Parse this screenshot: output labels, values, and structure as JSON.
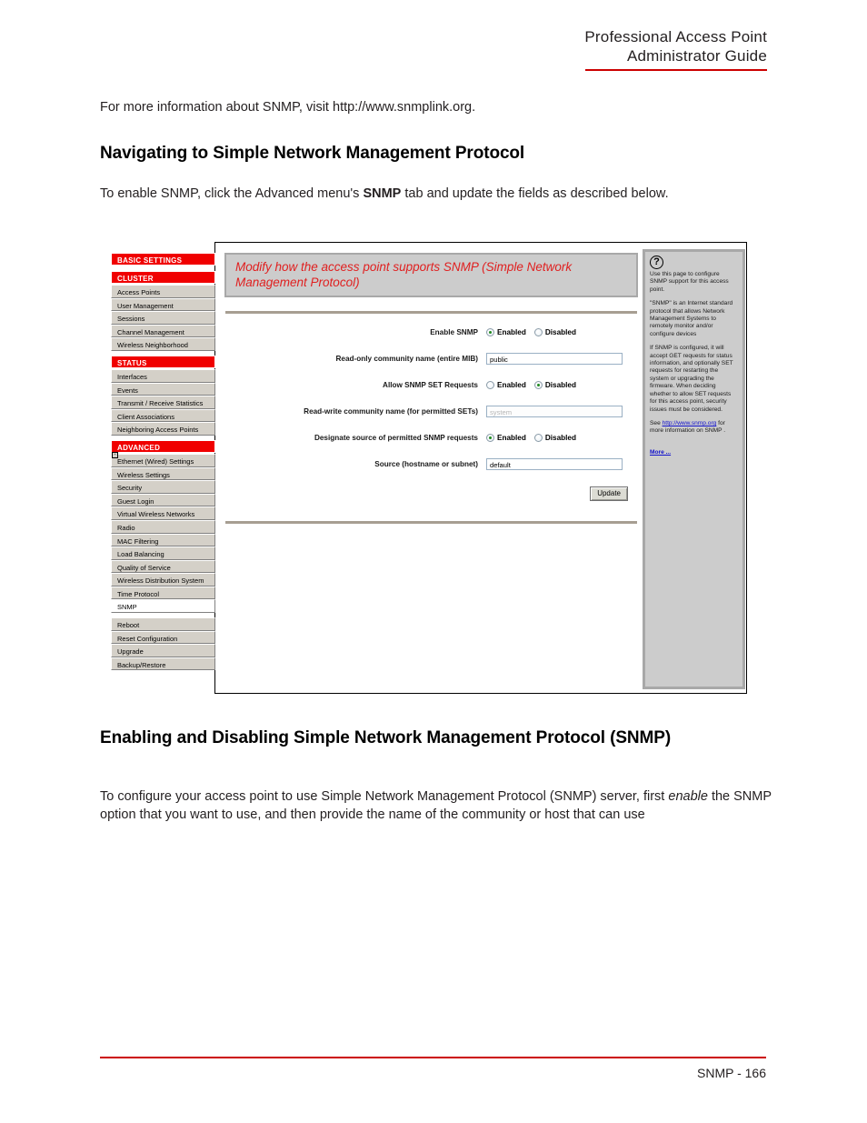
{
  "header": {
    "line1": "Professional Access Point",
    "line2": "Administrator Guide"
  },
  "intro": {
    "prefix": "For more information about SNMP, visit ",
    "link": "http://www.snmplink.org",
    "suffix": "."
  },
  "headings": {
    "navigating": "Navigating to Simple Network Management Protocol",
    "enabling": "Enabling and Disabling Simple Network Management Protocol (SNMP)"
  },
  "sub_line": {
    "pre": "To enable SNMP, click the Advanced menu's ",
    "bold": "SNMP",
    "post": " tab and update the fields as described below."
  },
  "lower_para": {
    "pre": "To configure your access point to use Simple Network Management Protocol (SNMP) server, first ",
    "italic": "enable",
    "post": " the SNMP option that you want to use, and then provide the name of the community or host that can use"
  },
  "footer": {
    "text": "SNMP - 166"
  },
  "screenshot": {
    "nav": {
      "groups": [
        {
          "header": "BASIC SETTINGS",
          "items": []
        },
        {
          "header": "CLUSTER",
          "items": [
            "Access Points",
            "User Management",
            "Sessions",
            "Channel Management",
            "Wireless Neighborhood"
          ]
        },
        {
          "header": "STATUS",
          "items": [
            "Interfaces",
            "Events",
            "Transmit / Receive Statistics",
            "Client Associations",
            "Neighboring Access Points"
          ]
        },
        {
          "header": "ADVANCED",
          "items": [
            "Ethernet (Wired) Settings",
            "Wireless Settings",
            "Security",
            "Guest Login",
            "Virtual Wireless Networks",
            "Radio",
            "MAC Filtering",
            "Load Balancing",
            "Quality of Service",
            "Wireless Distribution System",
            "Time Protocol",
            "SNMP"
          ]
        }
      ],
      "tail_items": [
        "Reboot",
        "Reset Configuration",
        "Upgrade",
        "Backup/Restore"
      ],
      "selected_item": "SNMP",
      "expander_glyph": "-"
    },
    "panel": {
      "title": "Modify how the access point supports SNMP (Simple Network Management Protocol)",
      "title_color": "#e02020",
      "rows": [
        {
          "label": "Enable SNMP",
          "type": "radio",
          "options": [
            "Enabled",
            "Disabled"
          ],
          "selected": "Enabled"
        },
        {
          "label": "Read-only community name (entire MIB)",
          "type": "text",
          "value": "public",
          "disabled": false
        },
        {
          "label": "Allow SNMP SET Requests",
          "type": "radio",
          "options": [
            "Enabled",
            "Disabled"
          ],
          "selected": "Disabled"
        },
        {
          "label": "Read-write community name (for permitted SETs)",
          "type": "text",
          "value": "system",
          "disabled": true
        },
        {
          "label": "Designate source of permitted SNMP requests",
          "type": "radio",
          "options": [
            "Enabled",
            "Disabled"
          ],
          "selected": "Enabled"
        },
        {
          "label": "Source (hostname or subnet)",
          "type": "text",
          "value": "default",
          "disabled": false
        }
      ],
      "update_label": "Update"
    },
    "help": {
      "icon": "?",
      "paragraphs": [
        "Use this page to configure SNMP support for this access point.",
        "\"SNMP\" is an Internet standard protocol that allows Network Management Systems to remotely monitor and/or configure devices",
        "If SNMP is configured, it will accept GET requests for status information, and optionally SET requests for restarting the system or upgrading the firmware. When deciding whether to allow SET requests for this access point, security issues must be considered."
      ],
      "see_prefix": "See ",
      "see_link": "http://www.snmp.org",
      "see_suffix": " for more information on SNMP .",
      "more_label": "More ..."
    }
  }
}
